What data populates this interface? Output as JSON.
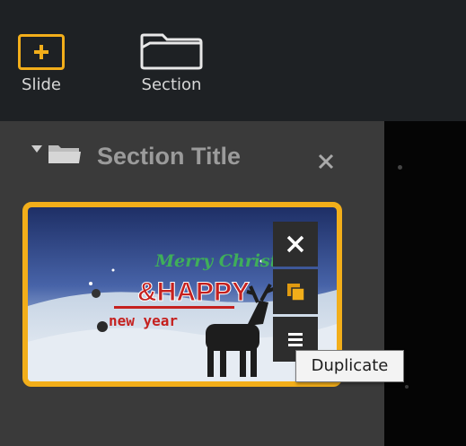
{
  "toolbar": {
    "slide_label": "Slide",
    "section_label": "Section"
  },
  "section": {
    "title": "Section Title",
    "collapse_icon": "caret-down-icon",
    "folder_icon": "folder-icon",
    "close_icon": "close-icon"
  },
  "slide_thumbnail": {
    "text_line1": "Merry Christm",
    "text_line2": "&HAPPY",
    "text_line3": "new year",
    "actions": [
      {
        "name": "delete",
        "icon": "close-icon"
      },
      {
        "name": "duplicate",
        "icon": "duplicate-icon"
      },
      {
        "name": "more",
        "icon": "menu-icon"
      }
    ]
  },
  "tooltip": {
    "text": "Duplicate"
  },
  "colors": {
    "accent": "#f2ae1a",
    "panel": "#3a3a3a",
    "toolbar": "#1e2124",
    "canvas": "#050505"
  }
}
